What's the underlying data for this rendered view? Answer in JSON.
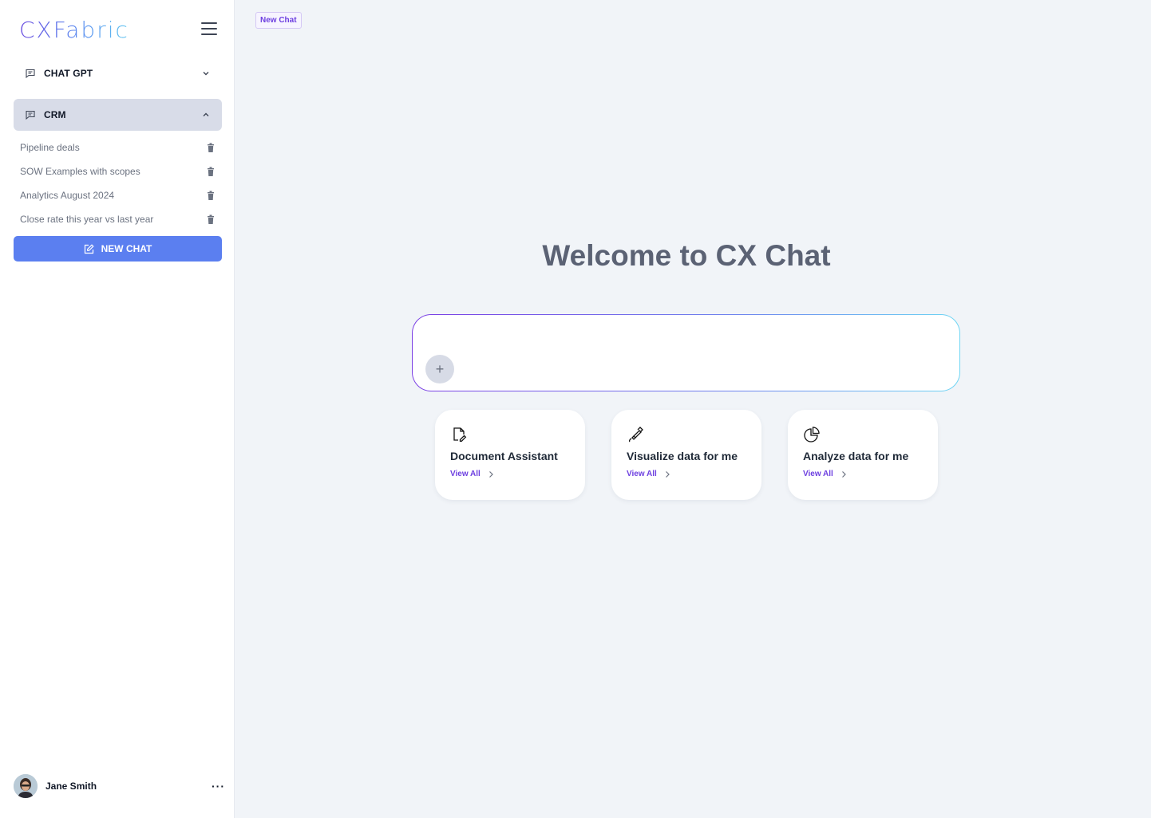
{
  "brand": {
    "logo_text": "CXFabric"
  },
  "sidebar": {
    "groups": [
      {
        "label": "CHAT GPT",
        "expanded": false
      },
      {
        "label": "CRM",
        "expanded": true
      }
    ],
    "crm_chats": [
      {
        "title": "Pipeline deals"
      },
      {
        "title": "SOW Examples with scopes"
      },
      {
        "title": "Analytics August 2024"
      },
      {
        "title": "Close rate this year vs last year"
      }
    ],
    "new_chat_label": "NEW CHAT",
    "user": {
      "name": "Jane Smith",
      "more": "···"
    }
  },
  "main": {
    "tag_label": "New Chat",
    "welcome_title": "Welcome to CX Chat",
    "input": {
      "value": "",
      "plus": "+"
    },
    "cards": [
      {
        "title": "Document Assistant",
        "link": "View All",
        "icon": "document-edit-icon"
      },
      {
        "title": "Visualize data for me",
        "link": "View All",
        "icon": "pen-tool-icon"
      },
      {
        "title": "Analyze data for me",
        "link": "View All",
        "icon": "pie-chart-icon"
      }
    ]
  },
  "colors": {
    "accent_blue": "#5b7ff0",
    "accent_purple": "#6d3fe0",
    "sidebar_active": "#d8dce8",
    "background": "#f1f4f8"
  }
}
